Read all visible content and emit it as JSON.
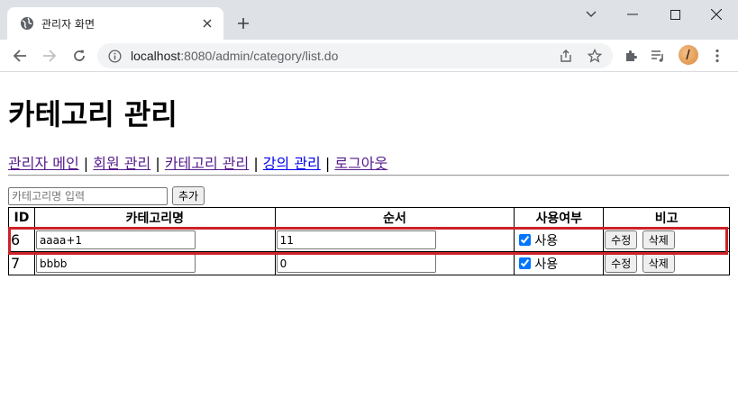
{
  "browser": {
    "tab_title": "관리자 화면",
    "url_host": "localhost",
    "url_path": ":8080/admin/category/list.do"
  },
  "page": {
    "heading": "카테고리 관리",
    "nav": [
      {
        "label": "관리자 메인"
      },
      {
        "label": "회원 관리"
      },
      {
        "label": "카테고리 관리"
      },
      {
        "label": "강의 관리"
      },
      {
        "label": "로그아웃"
      }
    ],
    "nav_separator": "|",
    "add_form": {
      "placeholder": "카테고리명 입력",
      "add_button": "추가"
    },
    "table": {
      "headers": [
        "ID",
        "카테고리명",
        "순서",
        "사용여부",
        "비고"
      ],
      "rows": [
        {
          "id": "6",
          "name": "aaaa+1",
          "order": "11",
          "use_checked": true,
          "use_label": "사용",
          "edit": "수정",
          "delete": "삭제"
        },
        {
          "id": "7",
          "name": "bbbb",
          "order": "0",
          "use_checked": true,
          "use_label": "사용",
          "edit": "수정",
          "delete": "삭제"
        }
      ]
    }
  },
  "colors": {
    "highlight": "#cc2229",
    "link_visited": "#551a8b",
    "link_unvisited": "#0000ee"
  }
}
